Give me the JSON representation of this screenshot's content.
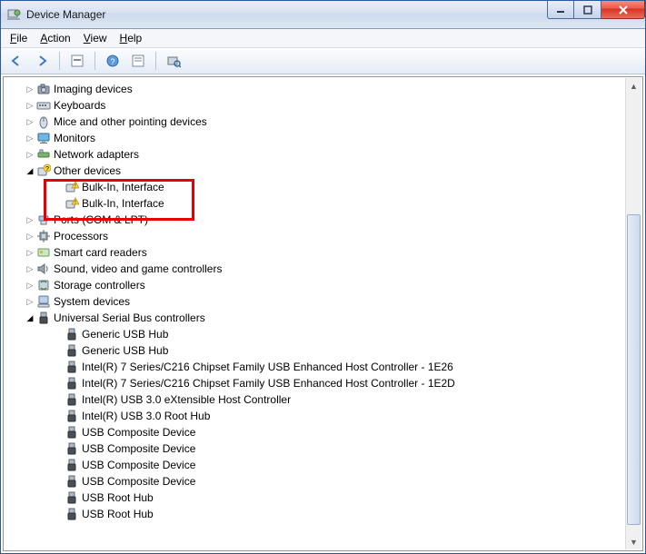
{
  "window": {
    "title": "Device Manager"
  },
  "menu": {
    "file": "File",
    "action": "Action",
    "view": "View",
    "help": "Help"
  },
  "tree": {
    "categories": [
      {
        "name": "Imaging devices",
        "icon": "camera",
        "expanded": false,
        "items": []
      },
      {
        "name": "Keyboards",
        "icon": "keyboard",
        "expanded": false,
        "items": []
      },
      {
        "name": "Mice and other pointing devices",
        "icon": "mouse",
        "expanded": false,
        "items": []
      },
      {
        "name": "Monitors",
        "icon": "monitor",
        "expanded": false,
        "items": []
      },
      {
        "name": "Network adapters",
        "icon": "network",
        "expanded": false,
        "items": []
      },
      {
        "name": "Other devices",
        "icon": "other",
        "expanded": true,
        "items": [
          {
            "name": "Bulk-In, Interface",
            "icon": "warning"
          },
          {
            "name": "Bulk-In, Interface",
            "icon": "warning"
          }
        ]
      },
      {
        "name": "Ports (COM & LPT)",
        "icon": "ports",
        "expanded": false,
        "items": []
      },
      {
        "name": "Processors",
        "icon": "cpu",
        "expanded": false,
        "items": []
      },
      {
        "name": "Smart card readers",
        "icon": "smartcard",
        "expanded": false,
        "items": []
      },
      {
        "name": "Sound, video and game controllers",
        "icon": "sound",
        "expanded": false,
        "items": []
      },
      {
        "name": "Storage controllers",
        "icon": "storage",
        "expanded": false,
        "items": []
      },
      {
        "name": "System devices",
        "icon": "system",
        "expanded": false,
        "items": []
      },
      {
        "name": "Universal Serial Bus controllers",
        "icon": "usb",
        "expanded": true,
        "items": [
          {
            "name": "Generic USB Hub",
            "icon": "usb"
          },
          {
            "name": "Generic USB Hub",
            "icon": "usb"
          },
          {
            "name": "Intel(R) 7 Series/C216 Chipset Family USB Enhanced Host Controller - 1E26",
            "icon": "usb"
          },
          {
            "name": "Intel(R) 7 Series/C216 Chipset Family USB Enhanced Host Controller - 1E2D",
            "icon": "usb"
          },
          {
            "name": "Intel(R) USB 3.0 eXtensible Host Controller",
            "icon": "usb"
          },
          {
            "name": "Intel(R) USB 3.0 Root Hub",
            "icon": "usb"
          },
          {
            "name": "USB Composite Device",
            "icon": "usb"
          },
          {
            "name": "USB Composite Device",
            "icon": "usb"
          },
          {
            "name": "USB Composite Device",
            "icon": "usb"
          },
          {
            "name": "USB Composite Device",
            "icon": "usb"
          },
          {
            "name": "USB Root Hub",
            "icon": "usb"
          },
          {
            "name": "USB Root Hub",
            "icon": "usb"
          }
        ]
      }
    ]
  },
  "highlight": {
    "category_index": 5
  }
}
